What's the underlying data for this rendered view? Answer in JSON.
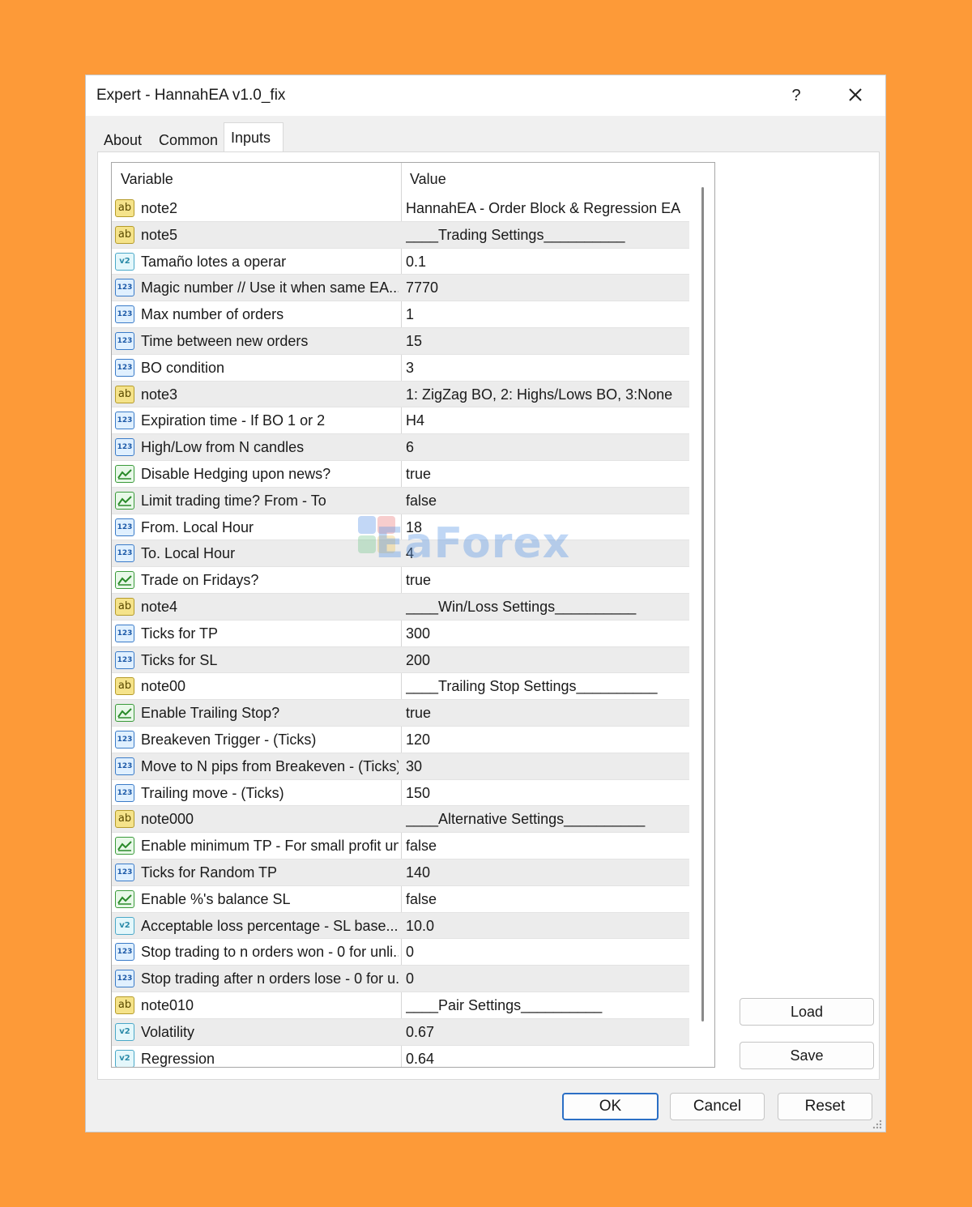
{
  "window": {
    "title": "Expert - HannahEA v1.0_fix",
    "help_label": "?"
  },
  "tabs": [
    {
      "label": "About"
    },
    {
      "label": "Common"
    },
    {
      "label": "Inputs"
    }
  ],
  "active_tab": "Inputs",
  "grid": {
    "columns": [
      "Variable",
      "Value"
    ],
    "rows": [
      {
        "type_icon": "ab",
        "variable": "note2",
        "value": "HannahEA - Order Block & Regression EA"
      },
      {
        "type_icon": "ab",
        "variable": "note5",
        "value": "____Trading Settings__________"
      },
      {
        "type_icon": "v2",
        "variable": "Tamaño lotes a operar",
        "value": "0.1"
      },
      {
        "type_icon": "123",
        "variable": "Magic number // Use it when same EA...",
        "value": "7770"
      },
      {
        "type_icon": "123",
        "variable": "Max number of orders",
        "value": "1"
      },
      {
        "type_icon": "123",
        "variable": "Time between new orders",
        "value": "15"
      },
      {
        "type_icon": "123",
        "variable": "BO condition",
        "value": "3"
      },
      {
        "type_icon": "ab",
        "variable": "note3",
        "value": "1: ZigZag BO, 2: Highs/Lows BO, 3:None"
      },
      {
        "type_icon": "123",
        "variable": "Expiration time - If BO 1 or 2",
        "value": "H4"
      },
      {
        "type_icon": "123",
        "variable": "High/Low from N candles",
        "value": "6"
      },
      {
        "type_icon": "bool",
        "variable": "Disable Hedging upon news?",
        "value": "true"
      },
      {
        "type_icon": "bool",
        "variable": "Limit trading time? From - To",
        "value": "false"
      },
      {
        "type_icon": "123",
        "variable": "From. Local Hour",
        "value": "18"
      },
      {
        "type_icon": "123",
        "variable": "To. Local Hour",
        "value": "4"
      },
      {
        "type_icon": "bool",
        "variable": "Trade on Fridays?",
        "value": "true"
      },
      {
        "type_icon": "ab",
        "variable": "note4",
        "value": "____Win/Loss Settings__________"
      },
      {
        "type_icon": "123",
        "variable": "Ticks for TP",
        "value": "300"
      },
      {
        "type_icon": "123",
        "variable": "Ticks for SL",
        "value": "200"
      },
      {
        "type_icon": "ab",
        "variable": "note00",
        "value": "____Trailing Stop Settings__________"
      },
      {
        "type_icon": "bool",
        "variable": "Enable Trailing Stop?",
        "value": "true"
      },
      {
        "type_icon": "123",
        "variable": "Breakeven Trigger - (Ticks)",
        "value": "120"
      },
      {
        "type_icon": "123",
        "variable": "Move to N pips from Breakeven - (Ticks)",
        "value": "30"
      },
      {
        "type_icon": "123",
        "variable": "Trailing move - (Ticks)",
        "value": "150"
      },
      {
        "type_icon": "ab",
        "variable": "note000",
        "value": "____Alternative Settings__________"
      },
      {
        "type_icon": "bool",
        "variable": "Enable minimum TP - For small profit un...",
        "value": "false"
      },
      {
        "type_icon": "123",
        "variable": "Ticks for Random TP",
        "value": "140"
      },
      {
        "type_icon": "bool",
        "variable": "Enable %'s balance SL",
        "value": "false"
      },
      {
        "type_icon": "v2",
        "variable": "Acceptable loss percentage - SL base...",
        "value": "10.0"
      },
      {
        "type_icon": "123",
        "variable": "Stop trading to n orders won - 0 for unli...",
        "value": "0"
      },
      {
        "type_icon": "123",
        "variable": "Stop trading after n orders lose - 0 for u...",
        "value": "0"
      },
      {
        "type_icon": "ab",
        "variable": "note010",
        "value": "____Pair Settings__________"
      },
      {
        "type_icon": "v2",
        "variable": "Volatility",
        "value": "0.67"
      },
      {
        "type_icon": "v2",
        "variable": "Regression",
        "value": "0.64"
      }
    ]
  },
  "watermark": "EaForex",
  "buttons": {
    "load": "Load",
    "save": "Save",
    "ok": "OK",
    "cancel": "Cancel",
    "reset": "Reset"
  },
  "colors": {
    "background": "#fd9a38",
    "ok_border": "#2b6fc5"
  }
}
